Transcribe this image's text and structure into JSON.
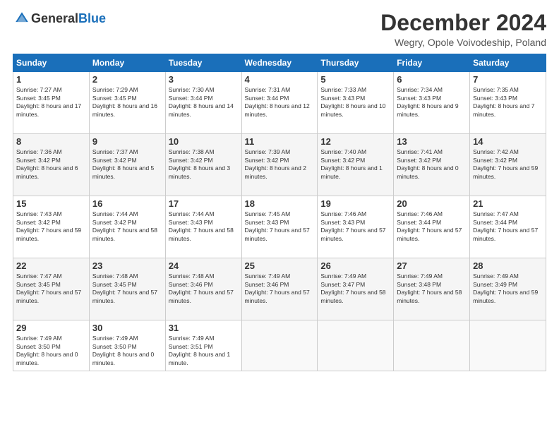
{
  "header": {
    "logo_general": "General",
    "logo_blue": "Blue",
    "month_title": "December 2024",
    "location": "Wegry, Opole Voivodeship, Poland"
  },
  "weekdays": [
    "Sunday",
    "Monday",
    "Tuesday",
    "Wednesday",
    "Thursday",
    "Friday",
    "Saturday"
  ],
  "weeks": [
    [
      {
        "day": "1",
        "sunrise": "7:27 AM",
        "sunset": "3:45 PM",
        "daylight": "8 hours and 17 minutes."
      },
      {
        "day": "2",
        "sunrise": "7:29 AM",
        "sunset": "3:45 PM",
        "daylight": "8 hours and 16 minutes."
      },
      {
        "day": "3",
        "sunrise": "7:30 AM",
        "sunset": "3:44 PM",
        "daylight": "8 hours and 14 minutes."
      },
      {
        "day": "4",
        "sunrise": "7:31 AM",
        "sunset": "3:44 PM",
        "daylight": "8 hours and 12 minutes."
      },
      {
        "day": "5",
        "sunrise": "7:33 AM",
        "sunset": "3:43 PM",
        "daylight": "8 hours and 10 minutes."
      },
      {
        "day": "6",
        "sunrise": "7:34 AM",
        "sunset": "3:43 PM",
        "daylight": "8 hours and 9 minutes."
      },
      {
        "day": "7",
        "sunrise": "7:35 AM",
        "sunset": "3:43 PM",
        "daylight": "8 hours and 7 minutes."
      }
    ],
    [
      {
        "day": "8",
        "sunrise": "7:36 AM",
        "sunset": "3:42 PM",
        "daylight": "8 hours and 6 minutes."
      },
      {
        "day": "9",
        "sunrise": "7:37 AM",
        "sunset": "3:42 PM",
        "daylight": "8 hours and 5 minutes."
      },
      {
        "day": "10",
        "sunrise": "7:38 AM",
        "sunset": "3:42 PM",
        "daylight": "8 hours and 3 minutes."
      },
      {
        "day": "11",
        "sunrise": "7:39 AM",
        "sunset": "3:42 PM",
        "daylight": "8 hours and 2 minutes."
      },
      {
        "day": "12",
        "sunrise": "7:40 AM",
        "sunset": "3:42 PM",
        "daylight": "8 hours and 1 minute."
      },
      {
        "day": "13",
        "sunrise": "7:41 AM",
        "sunset": "3:42 PM",
        "daylight": "8 hours and 0 minutes."
      },
      {
        "day": "14",
        "sunrise": "7:42 AM",
        "sunset": "3:42 PM",
        "daylight": "7 hours and 59 minutes."
      }
    ],
    [
      {
        "day": "15",
        "sunrise": "7:43 AM",
        "sunset": "3:42 PM",
        "daylight": "7 hours and 59 minutes."
      },
      {
        "day": "16",
        "sunrise": "7:44 AM",
        "sunset": "3:42 PM",
        "daylight": "7 hours and 58 minutes."
      },
      {
        "day": "17",
        "sunrise": "7:44 AM",
        "sunset": "3:43 PM",
        "daylight": "7 hours and 58 minutes."
      },
      {
        "day": "18",
        "sunrise": "7:45 AM",
        "sunset": "3:43 PM",
        "daylight": "7 hours and 57 minutes."
      },
      {
        "day": "19",
        "sunrise": "7:46 AM",
        "sunset": "3:43 PM",
        "daylight": "7 hours and 57 minutes."
      },
      {
        "day": "20",
        "sunrise": "7:46 AM",
        "sunset": "3:44 PM",
        "daylight": "7 hours and 57 minutes."
      },
      {
        "day": "21",
        "sunrise": "7:47 AM",
        "sunset": "3:44 PM",
        "daylight": "7 hours and 57 minutes."
      }
    ],
    [
      {
        "day": "22",
        "sunrise": "7:47 AM",
        "sunset": "3:45 PM",
        "daylight": "7 hours and 57 minutes."
      },
      {
        "day": "23",
        "sunrise": "7:48 AM",
        "sunset": "3:45 PM",
        "daylight": "7 hours and 57 minutes."
      },
      {
        "day": "24",
        "sunrise": "7:48 AM",
        "sunset": "3:46 PM",
        "daylight": "7 hours and 57 minutes."
      },
      {
        "day": "25",
        "sunrise": "7:49 AM",
        "sunset": "3:46 PM",
        "daylight": "7 hours and 57 minutes."
      },
      {
        "day": "26",
        "sunrise": "7:49 AM",
        "sunset": "3:47 PM",
        "daylight": "7 hours and 58 minutes."
      },
      {
        "day": "27",
        "sunrise": "7:49 AM",
        "sunset": "3:48 PM",
        "daylight": "7 hours and 58 minutes."
      },
      {
        "day": "28",
        "sunrise": "7:49 AM",
        "sunset": "3:49 PM",
        "daylight": "7 hours and 59 minutes."
      }
    ],
    [
      {
        "day": "29",
        "sunrise": "7:49 AM",
        "sunset": "3:50 PM",
        "daylight": "8 hours and 0 minutes."
      },
      {
        "day": "30",
        "sunrise": "7:49 AM",
        "sunset": "3:50 PM",
        "daylight": "8 hours and 0 minutes."
      },
      {
        "day": "31",
        "sunrise": "7:49 AM",
        "sunset": "3:51 PM",
        "daylight": "8 hours and 1 minute."
      },
      null,
      null,
      null,
      null
    ]
  ]
}
